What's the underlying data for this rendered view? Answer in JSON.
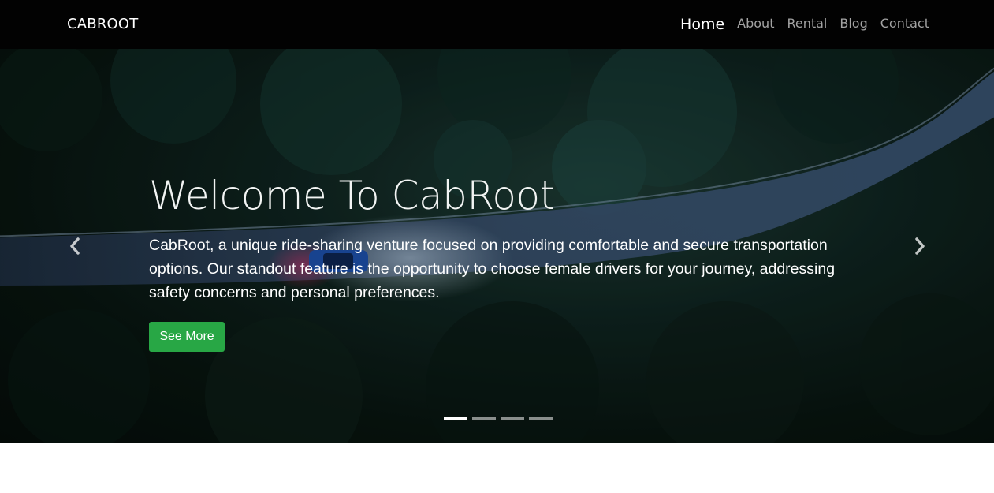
{
  "navbar": {
    "brand": "CABROOT",
    "links": [
      {
        "label": "Home",
        "active": true
      },
      {
        "label": "About",
        "active": false
      },
      {
        "label": "Rental",
        "active": false
      },
      {
        "label": "Blog",
        "active": false
      },
      {
        "label": "Contact",
        "active": false
      }
    ]
  },
  "hero": {
    "title": "Welcome To CabRoot",
    "text": "CabRoot, a unique ride-sharing venture focused on providing comfortable and secure transportation options. Our standout feature is the opportunity to choose female drivers for your journey, addressing safety concerns and personal preferences.",
    "button_label": "See More",
    "button_color": "#28a745",
    "prev_icon": "chevron-left-icon",
    "next_icon": "chevron-right-icon",
    "slide_count": 4,
    "active_slide": 1
  }
}
